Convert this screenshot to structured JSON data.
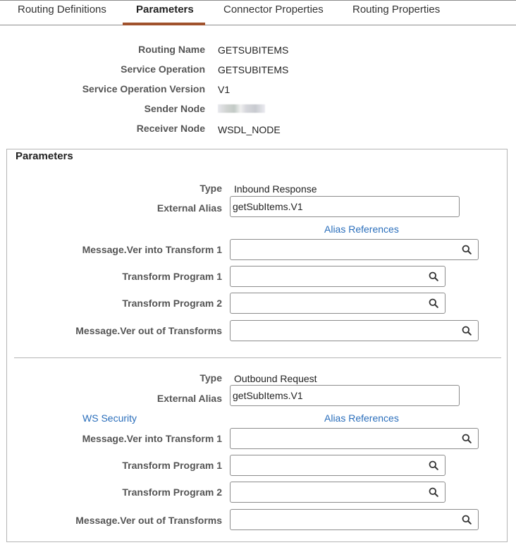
{
  "tabs": [
    {
      "label": "Routing Definitions",
      "active": false
    },
    {
      "label": "Parameters",
      "active": true
    },
    {
      "label": "Connector Properties",
      "active": false
    },
    {
      "label": "Routing Properties",
      "active": false
    }
  ],
  "accent_color": "#a0522d",
  "link_color": "#2a6ebb",
  "summary": {
    "routing_name": {
      "label": "Routing Name",
      "value": "GETSUBITEMS"
    },
    "service_operation": {
      "label": "Service Operation",
      "value": "GETSUBITEMS"
    },
    "service_operation_version": {
      "label": "Service Operation Version",
      "value": "V1"
    },
    "sender_node": {
      "label": "Sender Node",
      "value": "(redacted)"
    },
    "receiver_node": {
      "label": "Receiver Node",
      "value": "WSDL_NODE"
    }
  },
  "parameters": {
    "title": "Parameters",
    "sections": [
      {
        "type_label": "Type",
        "type_value": "Inbound Response",
        "external_alias_label": "External Alias",
        "external_alias_value": "getSubItems.V1",
        "alias_references_link": "Alias References",
        "msg_into_label": "Message.Ver into Transform 1",
        "msg_into_value": "",
        "transform1_label": "Transform Program 1",
        "transform1_value": "",
        "transform2_label": "Transform Program 2",
        "transform2_value": "",
        "msg_out_label": "Message.Ver out of Transforms",
        "msg_out_value": ""
      },
      {
        "type_label": "Type",
        "type_value": "Outbound Request",
        "external_alias_label": "External Alias",
        "external_alias_value": "getSubItems.V1",
        "ws_security_link": "WS Security",
        "alias_references_link": "Alias References",
        "msg_into_label": "Message.Ver into Transform 1",
        "msg_into_value": "",
        "transform1_label": "Transform Program 1",
        "transform1_value": "",
        "transform2_label": "Transform Program 2",
        "transform2_value": "",
        "msg_out_label": "Message.Ver out of Transforms",
        "msg_out_value": ""
      }
    ]
  }
}
